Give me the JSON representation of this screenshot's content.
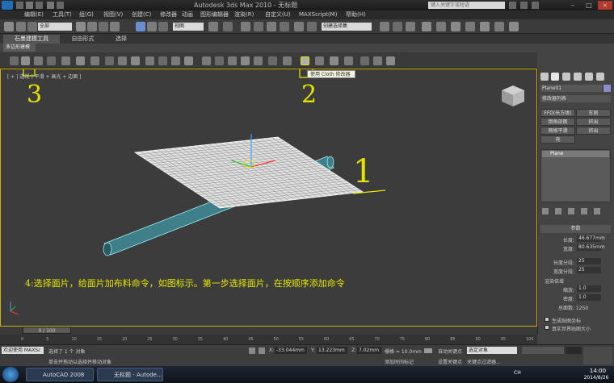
{
  "window": {
    "title": "Autodesk 3ds Max 2010 - 无标题",
    "search_placeholder": "键入关键字或短语"
  },
  "menubar": [
    "编辑(E)",
    "工具(T)",
    "组(G)",
    "视图(V)",
    "创建(C)",
    "修改器",
    "动画",
    "图形编辑器",
    "渲染(R)",
    "自定义(U)",
    "MAXScript(M)",
    "帮助(H)"
  ],
  "main_toolbar": {
    "selection_filter": "全部",
    "ref_coord": "视图",
    "named_selection": "创建选择集"
  },
  "ribbon": {
    "tabs": [
      "石墨建模工具",
      "自由形式",
      "选择"
    ],
    "subtab": "多边形建模"
  },
  "tooltip": "使用 Cloth 修改器",
  "viewport": {
    "label": "[ + ] 透视 ] 平滑 + 高光 + 边面 ]",
    "instruction": "4:选择面片，给面片加布料命令，如图标示。第一步选择面片，在按顺序添加命令",
    "annotations": [
      "3",
      "2",
      "1"
    ]
  },
  "command_panel": {
    "object_name": "Plane01",
    "modifier_list": "修改器列表",
    "buttons": [
      "FFD(长方体)",
      "车削",
      "倒角剖面",
      "挤出",
      "网格平滑",
      "挤出",
      "壳"
    ],
    "stack_item": "Plane",
    "params_title": "参数",
    "params": [
      {
        "label": "长度:",
        "value": "46.677mm"
      },
      {
        "label": "宽度:",
        "value": "80.635mm"
      },
      {
        "label": "长度分段:",
        "value": "25"
      },
      {
        "label": "宽度分段:",
        "value": "25"
      }
    ],
    "render_group": "渲染倍增",
    "render_params": [
      {
        "label": "缩放:",
        "value": "1.0"
      },
      {
        "label": "密度:",
        "value": "1.0"
      }
    ],
    "total_faces": "总面数: 1250",
    "checkbox1": "生成贴图坐标",
    "checkbox2": "真实世界贴图大小"
  },
  "timeline": {
    "slider": "0 / 100",
    "ticks": [
      "0",
      "5",
      "10",
      "15",
      "20",
      "25",
      "30",
      "35",
      "40",
      "45",
      "50",
      "55",
      "60",
      "65",
      "70",
      "75",
      "80",
      "85",
      "90",
      "95",
      "100"
    ]
  },
  "statusbar": {
    "welcome": "欢迎使用 MAXSc",
    "selected": "选择了 1 个 对象",
    "prompt": "单击并拖动以选择并移动对象",
    "x_label": "X:",
    "x_value": "-33.044mm",
    "y_label": "Y:",
    "y_value": "13.223mm",
    "z_label": "Z:",
    "z_value": "7.02mm",
    "grid": "栅格 = 10.0mm",
    "add_time_tag": "添加时间标记",
    "auto_key": "自动关键点",
    "selected_obj": "选定对象",
    "set_key": "设置关键点",
    "key_filters": "关键点过滤器..."
  },
  "taskbar": {
    "apps": [
      "AutoCAD 2008",
      "无标题 - Autode..."
    ],
    "lang": "CH",
    "time": "14:00",
    "date": "2014/8/26"
  }
}
